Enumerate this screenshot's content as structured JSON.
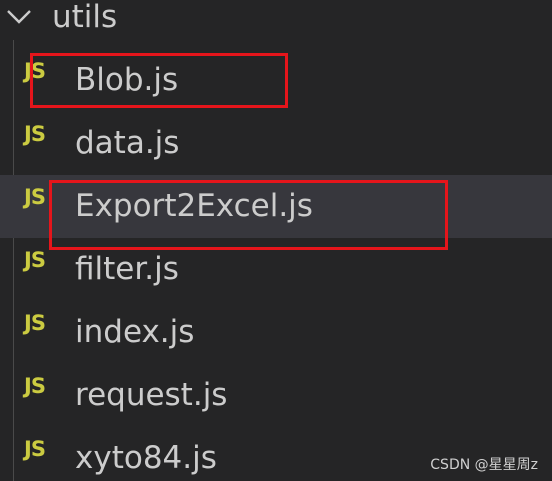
{
  "explorer": {
    "folder": {
      "label": "utils",
      "icon": "chevron-down-icon",
      "expanded": true
    },
    "files": [
      {
        "name": "Blob.js",
        "icon_text": "JS",
        "highlighted": true
      },
      {
        "name": "data.js",
        "icon_text": "JS"
      },
      {
        "name": "Export2Excel.js",
        "icon_text": "JS",
        "highlighted": true,
        "hovered": true
      },
      {
        "name": "filter.js",
        "icon_text": "JS"
      },
      {
        "name": "index.js",
        "icon_text": "JS"
      },
      {
        "name": "request.js",
        "icon_text": "JS"
      },
      {
        "name": "xyto84.js",
        "icon_text": "JS"
      }
    ]
  },
  "colors": {
    "background": "#252526",
    "text": "#cccccc",
    "js_icon": "#cbcb41",
    "hover_row": "#37373d",
    "highlight_box": "#e5151b"
  },
  "watermark": "CSDN @星星周z"
}
